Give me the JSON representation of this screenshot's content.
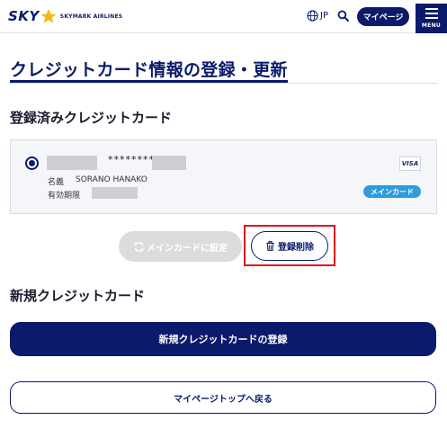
{
  "header": {
    "logo_text": "SKY",
    "logo_subtext": "SKYMARK AIRLINES",
    "language_label": "JP",
    "mypage_label": "マイページ",
    "menu_label": "MENU",
    "icons": [
      "star-icon",
      "globe-icon",
      "search-icon",
      "hamburger-icon"
    ]
  },
  "page": {
    "title": "クレジットカード情報の登録・更新"
  },
  "registered": {
    "heading": "登録済みクレジットカード",
    "card": {
      "selected": true,
      "number_masked": "********",
      "name_label": "名義",
      "name_value": "SORANO HANAKO",
      "expiry_label": "有効期限",
      "brand": "VISA",
      "badge": "メインカード"
    },
    "actions": {
      "set_main_label": "メインカードに設定",
      "set_main_enabled": false,
      "delete_label": "登録削除"
    }
  },
  "new_card": {
    "heading": "新規クレジットカード",
    "register_label": "新規クレジットカードの登録"
  },
  "footer": {
    "back_label": "マイページトップへ戻る"
  },
  "colors": {
    "brand_navy": "#0b1a6b",
    "badge_blue": "#2d9bdc",
    "highlight_red": "#e0141e",
    "disabled_gray": "#dcdcdc"
  }
}
